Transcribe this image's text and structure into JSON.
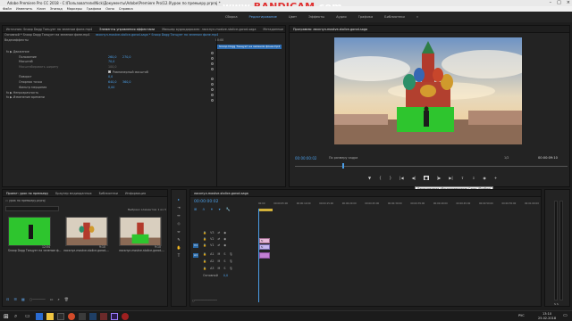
{
  "title_bar": {
    "text": "Adobe Premiere Pro CC 2018 - C:\\Пользователи\\Nick\\Документы\\Adobe\\Premiere Pro\\12.0\\урок по премьеру.prproj *"
  },
  "watermark": {
    "prefix": "www.",
    "brand": "BANDICAM",
    "suffix": ".com"
  },
  "menu": [
    "Файл",
    "Изменить",
    "Клип",
    "Эпизод",
    "Маркеры",
    "Графика",
    "Окно",
    "Справка"
  ],
  "workspaces": {
    "items": [
      "Сборка",
      "Редактирование",
      "Цвет",
      "Эффекты",
      "Аудио",
      "Графика",
      "Библиотеки"
    ],
    "active_index": 1,
    "more": "»"
  },
  "effect_controls": {
    "tabs": [
      "Источник: Snoop Dogg Танцует на зеленом фоне.mp4",
      "Элементы управления эффектами",
      "Микшер аудиодорожек: ласкнул-mostve-stolice-gorod-saga",
      "Метаданные"
    ],
    "active_tab": 1,
    "header_left": "Основной * Snoop Dogg Танцует на зеленом фоне.mp4",
    "header_right": "ласкнул-mostve-stolice-gorod-saga * Snoop Dogg Танцует на зеленом фоне.mp4",
    "timecode_short": "00:00",
    "clip_bar_label": "Snoop Dogg Танцует на зеленом фоне.mp4",
    "section_video": "Видеоэффекты",
    "rows": [
      {
        "label": "fx ▶ Движение",
        "value": "",
        "value2": ""
      },
      {
        "label": "Положение",
        "value": "260,0",
        "value2": "270,0"
      },
      {
        "label": "Масштаб",
        "value": "70,0",
        "value2": ""
      },
      {
        "label": "Масштабировать ширину",
        "value": "100,0",
        "value2": ""
      },
      {
        "label": "",
        "value": "Равномерный масштаб",
        "value2": ""
      },
      {
        "label": "Поворот",
        "value": "0,0",
        "value2": ""
      },
      {
        "label": "Опорная точка",
        "value": "640,0",
        "value2": "360,0"
      },
      {
        "label": "Фильтр мерцания",
        "value": "0,00",
        "value2": ""
      },
      {
        "label": "fx ▶ Непрозрачность",
        "value": "",
        "value2": ""
      },
      {
        "label": "fx ▶ Изменение времени",
        "value": "",
        "value2": ""
      }
    ]
  },
  "program": {
    "tab": "Программа: ласкнул-mostve-stolice-gorod-saga",
    "timecode": "00:00:00:02",
    "fit": "По размеру кадра",
    "zoom": "1/2",
    "duration": "00:00:09:10",
    "tooltip": "Переключение «Воспроизведение Стоп» (Пробел)"
  },
  "project": {
    "tabs": [
      "Проект: урок по премьеру",
      "Браузер медиаданных",
      "Библиотеки",
      "Информация"
    ],
    "active_tab": 0,
    "path": "урок по премьеру.prproj",
    "count": "Выбрано элементов: 1 из 3",
    "items": [
      {
        "name": "Snoop Dogg Танцует на зеленом ф...",
        "duration": "12:04",
        "kind": "green"
      },
      {
        "name": "ласкнул-mostve-stolice-gorod-...",
        "duration": "9:10",
        "kind": "city"
      },
      {
        "name": "ласкнул-mostve-stolice-gorod-...",
        "duration": "9:10",
        "kind": "citygreen"
      }
    ]
  },
  "timeline": {
    "tab": "ласкнул-mostve-stolice-gorod-saga",
    "timecode": "00:00:00:02",
    "ruler": [
      "00:00",
      "00:00:05:00",
      "00:00:10:00",
      "00:00:15:00",
      "00:00:20:00",
      "00:00:25:00",
      "00:00:30:00",
      "00:00:35:00",
      "00:00:40:00",
      "00:00:45:00",
      "00:00:50:00",
      "00:00:55:00",
      "00:01:00:00"
    ],
    "video_tracks": [
      "V3",
      "V2",
      "V1"
    ],
    "audio_tracks": [
      "A1",
      "A2",
      "A3"
    ],
    "master": "Основной",
    "master_value": "0,0",
    "clip_v2": "fx",
    "clip_v1": "fx"
  },
  "taskbar": {
    "time": "13:10",
    "date": "25.02.2018",
    "lang": "РУС"
  },
  "colors": {
    "accent": "#4a9de6",
    "green_screen": "#2ec52e",
    "audio_clip": "#c37fd3",
    "video_clip": "#c4b6ee"
  }
}
